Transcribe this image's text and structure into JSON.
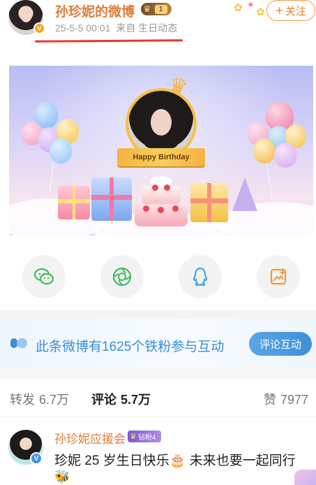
{
  "post": {
    "author": "孙珍妮的微博",
    "author_level": "1",
    "timestamp": "25-5-5 00:01",
    "source": "来自 生日动态",
    "follow_label": "关注",
    "follow_icon": "plus-icon"
  },
  "banner": {
    "ribbon_text": "Happy Birthday"
  },
  "share": {
    "items": [
      {
        "name": "wechat",
        "icon": "wechat-icon",
        "color": "#3dbb5c"
      },
      {
        "name": "moments",
        "icon": "moments-icon",
        "color": "#3dbb5c"
      },
      {
        "name": "qq",
        "icon": "qq-icon",
        "color": "#3a9be8"
      },
      {
        "name": "save-image",
        "icon": "save-image-icon",
        "color": "#f29a3a"
      }
    ]
  },
  "fans_bar": {
    "text": "此条微博有1625个铁粉参与互动",
    "button_label": "评论互动"
  },
  "tabs": [
    {
      "label": "转发",
      "count": "6.7万",
      "active": false
    },
    {
      "label": "评论",
      "count": "5.7万",
      "active": true
    },
    {
      "label": "赞",
      "count": "7977",
      "active": false
    }
  ],
  "comment": {
    "author": "孙珍妮应援会",
    "badge": "钻粉4",
    "text": "珍妮 25 岁生日快乐🎂 未来也要一起同行",
    "emoji": "🐝"
  },
  "colors": {
    "accent_orange": "#f07d2c",
    "username_orange": "#e07b3a",
    "link_blue": "#3a8ed6",
    "annotation_red": "#e53935"
  }
}
